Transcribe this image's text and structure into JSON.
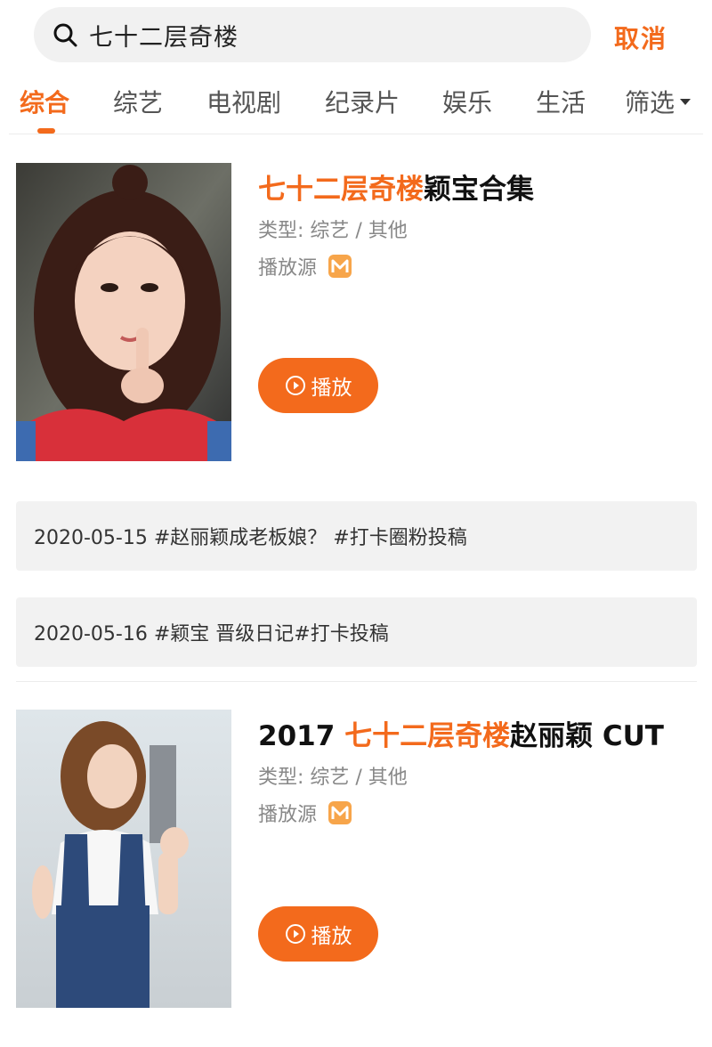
{
  "search": {
    "query": "七十二层奇楼",
    "cancel_label": "取消"
  },
  "tabs": [
    {
      "label": "综合",
      "active": true
    },
    {
      "label": "综艺",
      "active": false
    },
    {
      "label": "电视剧",
      "active": false
    },
    {
      "label": "纪录片",
      "active": false
    },
    {
      "label": "娱乐",
      "active": false
    },
    {
      "label": "生活",
      "active": false
    },
    {
      "label": "筛选",
      "active": false
    }
  ],
  "results": [
    {
      "title_highlight": "七十二层奇楼",
      "title_rest": "颖宝合集",
      "type": "类型: 综艺 / 其他",
      "source_label": "播放源",
      "play_label": "播放"
    },
    {
      "title_prefix": "2017 ",
      "title_highlight": "七十二层奇楼",
      "title_rest": "赵丽颖 CUT",
      "type": "类型: 综艺 / 其他",
      "source_label": "播放源",
      "play_label": "播放"
    }
  ],
  "topics": [
    "2020-05-15 #赵丽颖成老板娘？ #打卡圈粉投稿",
    "2020-05-16 #颖宝 晋级日记#打卡投稿"
  ],
  "colors": {
    "accent": "#f36a1c",
    "text_primary": "#111111",
    "text_secondary": "#888888",
    "surface": "#f2f2f2"
  },
  "icons": {
    "search": "search-icon",
    "source": "mango-tv-icon",
    "play": "play-circle-icon",
    "filter": "caret-down-icon"
  }
}
